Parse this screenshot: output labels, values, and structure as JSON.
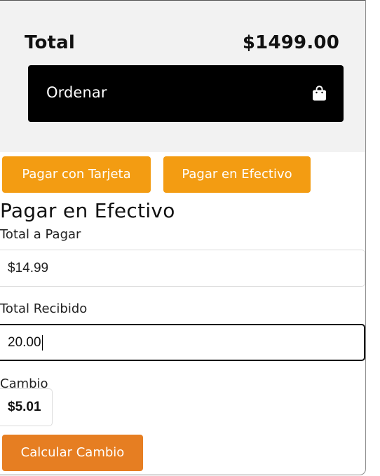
{
  "summary": {
    "total_label": "Total",
    "total_value": "$1499.00",
    "order_button": {
      "label": "Ordenar",
      "icon": "shopping-bag-icon"
    }
  },
  "payment_tabs": {
    "card": "Pagar con Tarjeta",
    "cash": "Pagar en Efectivo",
    "color": "#f39c12"
  },
  "cash_form": {
    "title": "Pagar en Efectivo",
    "total_label": "Total a Pagar",
    "total_value": "$14.99",
    "received_label": "Total Recibido",
    "received_value": "20.00",
    "change_label": "Cambio",
    "change_value": "$5.01",
    "calculate_button": "Calcular Cambio",
    "calculate_color": "#e67e22"
  }
}
